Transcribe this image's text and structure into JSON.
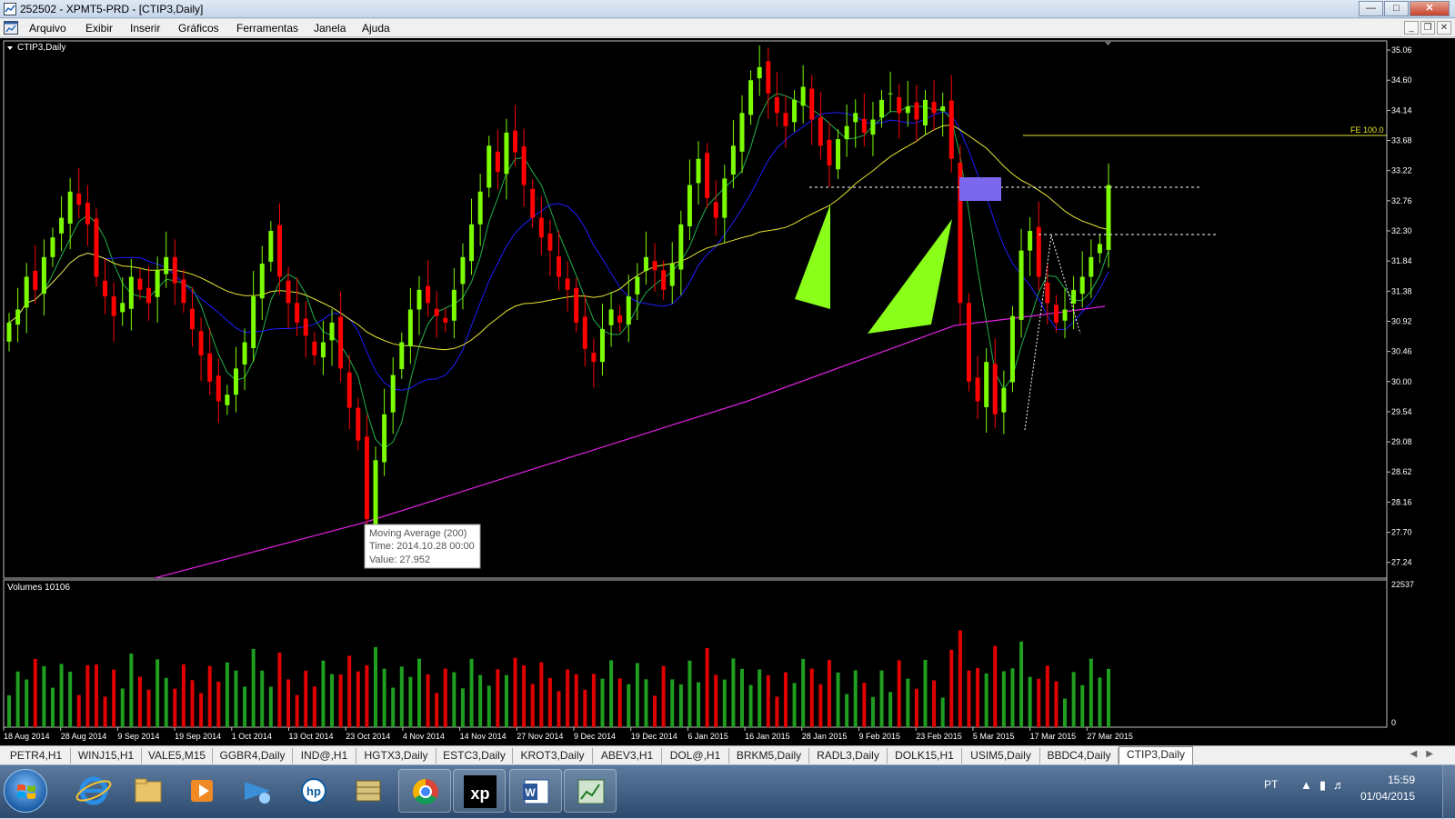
{
  "window": {
    "title": "252502 - XPMT5-PRD - [CTIP3,Daily]"
  },
  "menu": [
    "Arquivo",
    "Exibir",
    "Inserir",
    "Gráficos",
    "Ferramentas",
    "Janela",
    "Ajuda"
  ],
  "chart": {
    "header": "CTIP3,Daily",
    "price_labels": [
      "35.06",
      "34.60",
      "34.14",
      "33.68",
      "33.22",
      "32.76",
      "32.30",
      "31.84",
      "31.38",
      "30.92",
      "30.46",
      "30.00",
      "29.54",
      "29.08",
      "28.62",
      "28.16",
      "27.70",
      "27.24"
    ],
    "date_labels": [
      "18 Aug 2014",
      "28 Aug 2014",
      "9 Sep 2014",
      "19 Sep 2014",
      "1 Oct 2014",
      "13 Oct 2014",
      "23 Oct 2014",
      "4 Nov 2014",
      "14 Nov 2014",
      "27 Nov 2014",
      "9 Dec 2014",
      "19 Dec 2014",
      "6 Jan 2015",
      "16 Jan 2015",
      "28 Jan 2015",
      "9 Feb 2015",
      "23 Feb 2015",
      "5 Mar 2015",
      "17 Mar 2015",
      "27 Mar 2015"
    ],
    "fe_label": "FE 100.0",
    "tooltip": {
      "line1": "Moving Average (200)",
      "line2": "Time: 2014.10.28 00:00",
      "line3": "Value: 27.952"
    },
    "volume_header": "Volumes 10106",
    "volume_max_label": "22537",
    "volume_min_label": "0",
    "colors": {
      "bull": "#7cfc00",
      "bear": "#ff0000",
      "ma_green": "#22b14c",
      "ma_blue": "#1e1eff",
      "ma_yellow": "#e6e632",
      "ma_magenta": "#e020e0",
      "volume_up": "#1f9e1f",
      "volume_down": "#e00000",
      "shape": "#8aff1a",
      "box": "#7b68ee"
    }
  },
  "chart_data": {
    "type": "candlestick",
    "symbol": "CTIP3",
    "timeframe": "Daily",
    "ylim": [
      27.0,
      35.2
    ],
    "x_labels": [
      "18 Aug 2014",
      "28 Aug 2014",
      "9 Sep 2014",
      "19 Sep 2014",
      "1 Oct 2014",
      "13 Oct 2014",
      "23 Oct 2014",
      "4 Nov 2014",
      "14 Nov 2014",
      "27 Nov 2014",
      "9 Dec 2014",
      "19 Dec 2014",
      "6 Jan 2015",
      "16 Jan 2015",
      "28 Jan 2015",
      "9 Feb 2015",
      "23 Feb 2015",
      "5 Mar 2015",
      "17 Mar 2015",
      "27 Mar 2015"
    ],
    "closes": [
      30.9,
      31.1,
      31.6,
      31.4,
      31.9,
      32.2,
      32.5,
      32.9,
      32.7,
      32.4,
      31.6,
      31.3,
      31.0,
      31.2,
      31.6,
      31.4,
      31.2,
      31.7,
      31.9,
      31.5,
      31.2,
      30.8,
      30.4,
      30.0,
      29.7,
      29.8,
      30.2,
      30.6,
      31.3,
      31.8,
      32.3,
      31.6,
      31.2,
      30.9,
      30.7,
      30.4,
      30.6,
      30.9,
      30.2,
      29.6,
      29.1,
      27.9,
      28.8,
      29.5,
      30.1,
      30.6,
      31.1,
      31.4,
      31.2,
      31.0,
      30.9,
      31.4,
      31.9,
      32.4,
      32.9,
      33.6,
      33.2,
      33.8,
      33.5,
      33.0,
      32.5,
      32.2,
      32.0,
      31.6,
      31.4,
      30.9,
      30.5,
      30.3,
      30.8,
      31.1,
      30.9,
      31.3,
      31.6,
      31.9,
      31.7,
      31.4,
      31.8,
      32.4,
      33.0,
      33.4,
      32.8,
      32.5,
      33.1,
      33.6,
      34.1,
      34.6,
      34.8,
      34.4,
      34.1,
      33.9,
      34.3,
      34.5,
      34.0,
      33.6,
      33.3,
      33.7,
      33.9,
      34.1,
      33.8,
      34.0,
      34.3,
      34.4,
      34.1,
      34.2,
      34.0,
      34.3,
      34.1,
      34.2,
      33.4,
      31.2,
      30.0,
      29.7,
      30.3,
      29.5,
      29.9,
      31.0,
      32.0,
      32.3,
      31.6,
      31.2,
      30.9,
      31.1,
      31.4,
      31.6,
      31.9,
      32.1,
      33.0
    ],
    "moving_averages": [
      {
        "period": 200,
        "color": "magenta",
        "tooltip_point": {
          "date": "2014.10.28",
          "value": 27.952
        }
      }
    ],
    "fe_level": 100.0
  }
}
